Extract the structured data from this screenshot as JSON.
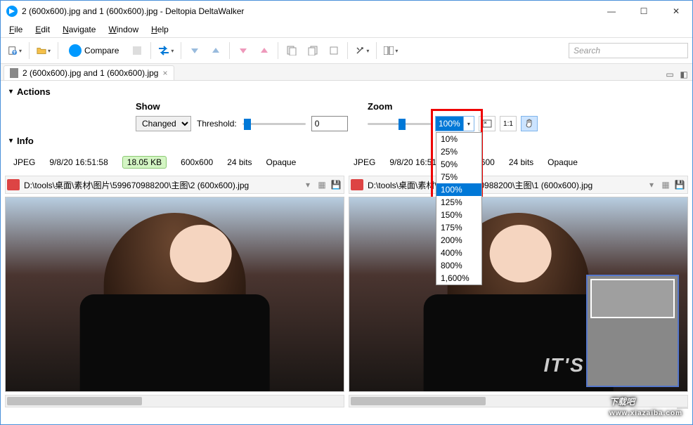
{
  "window": {
    "title": "2 (600x600).jpg and 1 (600x600).jpg - Deltopia DeltaWalker"
  },
  "menu": {
    "file": "File",
    "edit": "Edit",
    "navigate": "Navigate",
    "window": "Window",
    "help": "Help"
  },
  "toolbar": {
    "compare": "Compare",
    "search_placeholder": "Search"
  },
  "tab": {
    "label": "2 (600x600).jpg and 1 (600x600).jpg"
  },
  "sections": {
    "actions": "Actions",
    "info": "Info"
  },
  "show": {
    "heading": "Show",
    "mode": "Changed",
    "threshold_label": "Threshold:",
    "threshold_value": "0"
  },
  "zoom": {
    "heading": "Zoom",
    "value": "100%",
    "options": [
      "10%",
      "25%",
      "50%",
      "75%",
      "100%",
      "125%",
      "150%",
      "175%",
      "200%",
      "400%",
      "800%",
      "1,600%"
    ],
    "selected_index": 4,
    "oneone": "1:1"
  },
  "info": {
    "left": {
      "format": "JPEG",
      "date": "9/8/20 16:51:58",
      "size": "18.05 KB",
      "dims": "600x600",
      "depth": "24 bits",
      "alpha": "Opaque"
    },
    "right": {
      "format": "JPEG",
      "date": "9/8/20 16:51:58",
      "dims": "600x600",
      "depth": "24 bits",
      "alpha": "Opaque"
    }
  },
  "paths": {
    "left": "D:\\tools\\桌面\\素材\\图片\\599670988200\\主图\\2 (600x600).jpg",
    "right": "D:\\tools\\桌面\\素材\\图片\\599670988200\\主图\\1 (600x600).jpg"
  },
  "image_text": {
    "right_shirt": "IT'S"
  },
  "watermark": {
    "big": "下载吧",
    "small": "www.xiazaiba.com"
  }
}
